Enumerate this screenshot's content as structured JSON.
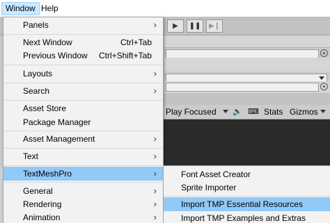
{
  "menubar": {
    "items": [
      {
        "label": "Window",
        "active": true
      },
      {
        "label": "Help",
        "active": false
      }
    ]
  },
  "editor": {
    "game_toolbar": {
      "play_mode": "Play Focused",
      "stats": "Stats",
      "gizmos": "Gizmos"
    }
  },
  "window_menu": {
    "items": [
      {
        "label": "Panels",
        "shortcut": "",
        "submenu": true
      },
      {
        "label": "Next Window",
        "shortcut": "Ctrl+Tab",
        "submenu": false
      },
      {
        "label": "Previous Window",
        "shortcut": "Ctrl+Shift+Tab",
        "submenu": false
      },
      {
        "label": "Layouts",
        "shortcut": "",
        "submenu": true
      },
      {
        "label": "Search",
        "shortcut": "",
        "submenu": true
      },
      {
        "label": "Asset Store",
        "shortcut": "",
        "submenu": false
      },
      {
        "label": "Package Manager",
        "shortcut": "",
        "submenu": false
      },
      {
        "label": "Asset Management",
        "shortcut": "",
        "submenu": true
      },
      {
        "label": "Text",
        "shortcut": "",
        "submenu": true
      },
      {
        "label": "TextMeshPro",
        "shortcut": "",
        "submenu": true,
        "highlighted": true
      },
      {
        "label": "General",
        "shortcut": "",
        "submenu": true
      },
      {
        "label": "Rendering",
        "shortcut": "",
        "submenu": true
      },
      {
        "label": "Animation",
        "shortcut": "",
        "submenu": true
      }
    ]
  },
  "textmeshpro_submenu": {
    "items": [
      {
        "label": "Font Asset Creator",
        "highlighted": false
      },
      {
        "label": "Sprite Importer",
        "highlighted": false
      },
      {
        "label": "Import TMP Essential Resources",
        "highlighted": true
      },
      {
        "label": "Import TMP Examples and Extras",
        "highlighted": false
      }
    ]
  },
  "icons": {
    "chevron": "›",
    "play": "▶",
    "pause": "❚❚",
    "step": "▶❙"
  },
  "colors": {
    "menu_bg": "#f2f2f2",
    "highlight": "#91c9f7",
    "menubar_active": "#cce8ff"
  }
}
